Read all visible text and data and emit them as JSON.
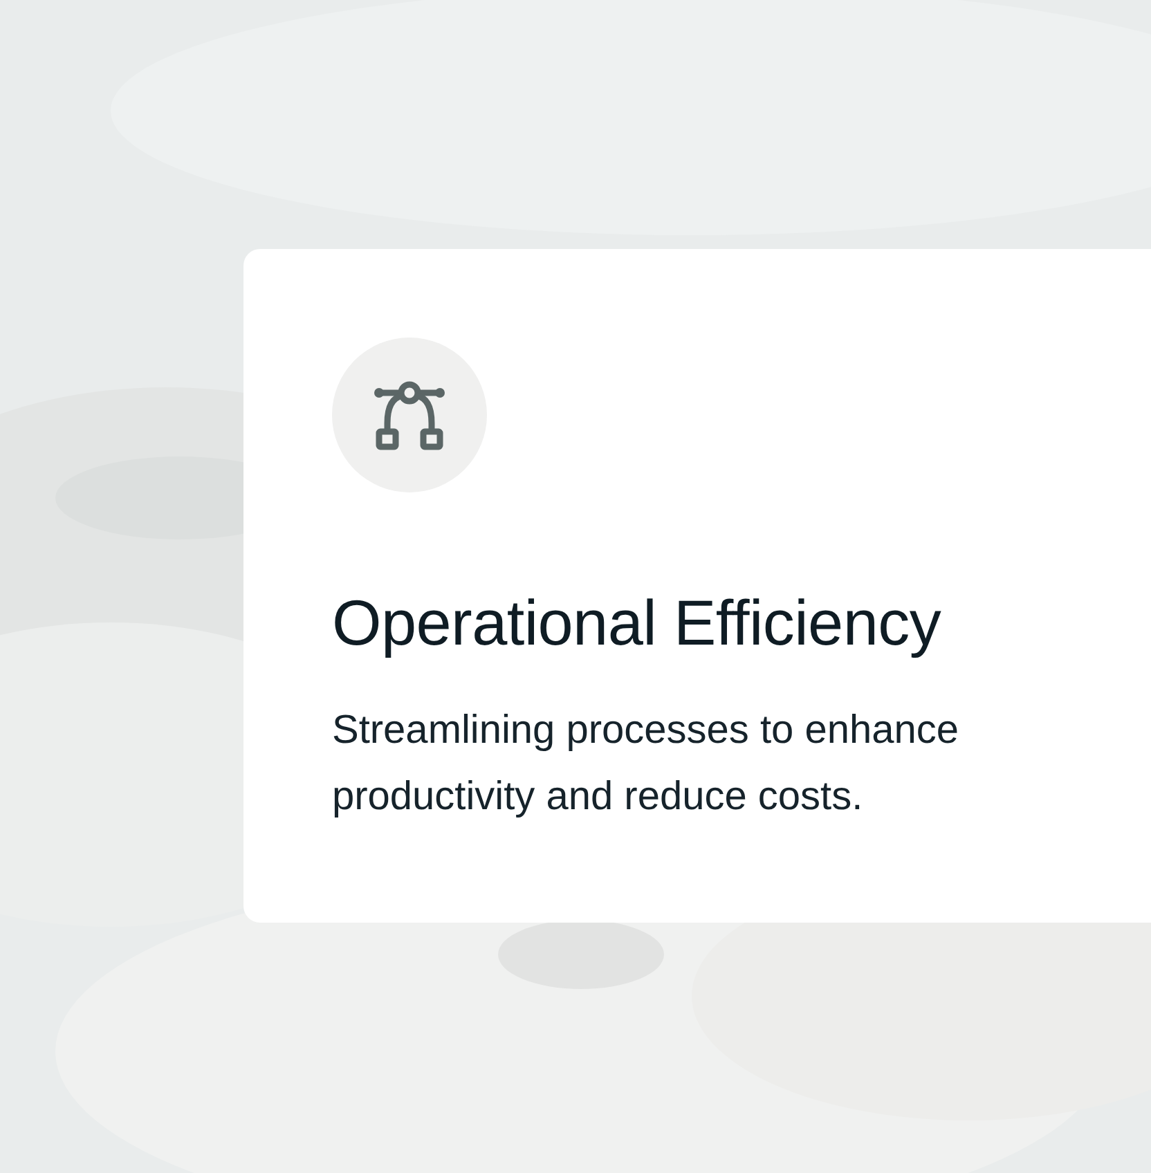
{
  "card": {
    "title": "Operational Efficiency",
    "description": "Streamlining processes to enhance productivity and reduce costs."
  }
}
